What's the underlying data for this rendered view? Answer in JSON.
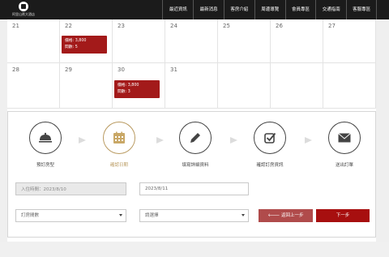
{
  "colors": {
    "topbar": "#1b1b1b",
    "accent_red": "#a31a1a",
    "active_step": "#b99a60"
  },
  "header": {
    "logo_text": "阿里山賓大酒店",
    "logo_icon": "hotel-logo-icon",
    "nav": [
      "最近資訊",
      "最新消息",
      "客房介紹",
      "周邊導覽",
      "會員專區",
      "交通指南",
      "客服專區"
    ]
  },
  "calendar": {
    "weeks": [
      {
        "days": [
          "21",
          "22",
          "23",
          "24",
          "25",
          "26",
          "27"
        ],
        "badges": [
          {
            "day_index": 1,
            "price": "價格: 3,800",
            "rooms": "間數: 5"
          }
        ]
      },
      {
        "days": [
          "28",
          "29",
          "30",
          "31",
          "",
          "",
          ""
        ],
        "badges": [
          {
            "day_index": 2,
            "price": "價格: 3,800",
            "rooms": "間數: 3"
          }
        ]
      }
    ]
  },
  "booking": {
    "steps": [
      {
        "label": "預訂房型",
        "icon": "room-service-bell-icon"
      },
      {
        "label": "確認日期",
        "icon": "calendar-icon"
      },
      {
        "label": "填寫詳細資料",
        "icon": "pencil-icon"
      },
      {
        "label": "確認訂房資訊",
        "icon": "checkbox-icon"
      },
      {
        "label": "送出訂單",
        "icon": "envelope-icon"
      }
    ],
    "active_step": 1,
    "checkin_value": "入住時間：2023/8/10",
    "checkout_value": "2023/8/11",
    "room_count_select": "訂房間數",
    "bed_select": "請選擇",
    "prev_label": "返回上一步",
    "next_label": "下一步"
  }
}
